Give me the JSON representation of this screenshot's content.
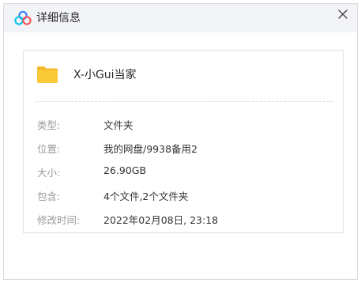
{
  "dialog": {
    "title": "详细信息",
    "app_icon": "baidu-netdisk-logo",
    "close_icon": "close-icon"
  },
  "file": {
    "icon": "folder-icon",
    "icon_color": "#f9c936",
    "name": "X-小Gui当家"
  },
  "properties": [
    {
      "label": "类型:",
      "value": "文件夹"
    },
    {
      "label": "位置:",
      "value": "我的网盘/9938备用2"
    },
    {
      "label": "大小:",
      "value": "26.90GB"
    },
    {
      "label": "包含:",
      "value": "4个文件,2个文件夹"
    },
    {
      "label": "修改时间:",
      "value": "2022年02月08日, 23:18"
    }
  ],
  "colors": {
    "titlebar_bg": "#f2f4f7",
    "logo_blue": "#2f7bff",
    "logo_cyan": "#00c0e8",
    "logo_red": "#ff4f4f"
  }
}
